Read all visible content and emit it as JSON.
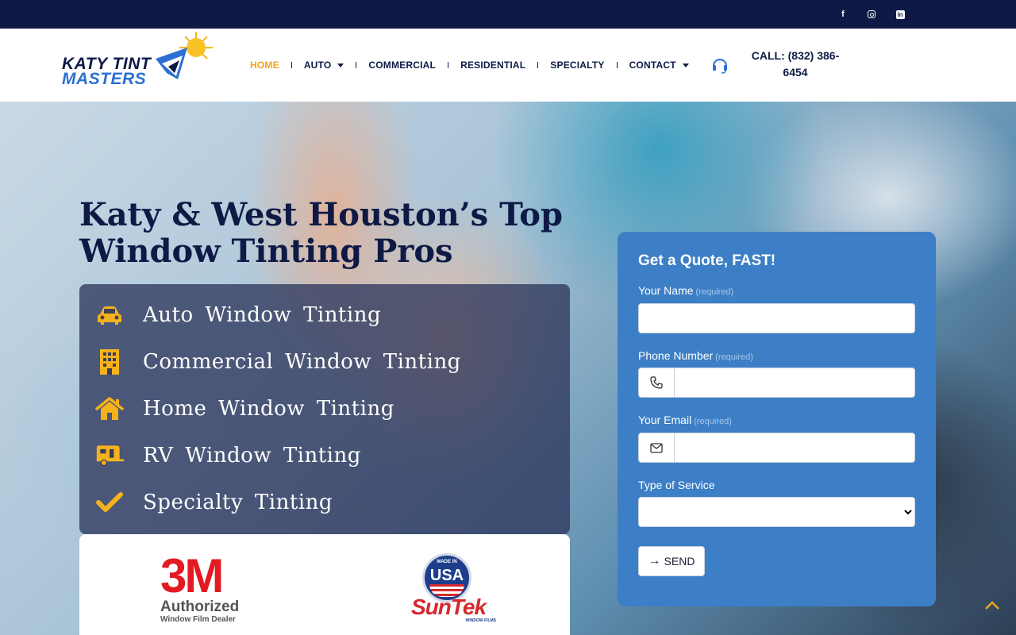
{
  "topbar": {
    "social": [
      {
        "name": "facebook-icon"
      },
      {
        "name": "instagram-icon"
      },
      {
        "name": "linkedin-icon"
      }
    ]
  },
  "logo": {
    "line1": "KATY TINT",
    "line2": "MASTERS"
  },
  "nav": {
    "items": [
      {
        "label": "HOME",
        "active": true
      },
      {
        "label": "AUTO",
        "dropdown": true
      },
      {
        "label": "COMMERCIAL"
      },
      {
        "label": "RESIDENTIAL"
      },
      {
        "label": "SPECIALTY"
      },
      {
        "label": "CONTACT",
        "dropdown": true
      }
    ]
  },
  "call": {
    "line1": "CALL: (832) 386-",
    "line2": "6454"
  },
  "hero": {
    "title_line1": "Katy & West Houston’s Top",
    "title_line2": "Window Tinting Pros",
    "services": [
      {
        "label": "Auto Window Tinting",
        "icon": "car-icon"
      },
      {
        "label": "Commercial Window Tinting",
        "icon": "building-icon"
      },
      {
        "label": "Home Window Tinting",
        "icon": "home-icon"
      },
      {
        "label": "RV Window Tinting",
        "icon": "rv-icon"
      },
      {
        "label": "Specialty Tinting",
        "icon": "check-icon"
      }
    ]
  },
  "brands": {
    "threem": {
      "logo": "3M",
      "line1": "Authorized",
      "line2": "Window Film Dealer"
    },
    "suntek": {
      "badge_top": "MADE IN",
      "badge": "USA",
      "logo": "SunTek",
      "sub": "WINDOW FILMS"
    }
  },
  "quote": {
    "title": "Get a Quote, FAST!",
    "required_note": "(required)",
    "name_label": "Your Name",
    "phone_label": "Phone Number",
    "email_label": "Your Email",
    "service_label": "Type of Service",
    "service_value": "",
    "send_label": "SEND"
  },
  "colors": {
    "navy": "#0e1a45",
    "accent": "#f0a523",
    "form_blue": "#3d7fc6"
  }
}
